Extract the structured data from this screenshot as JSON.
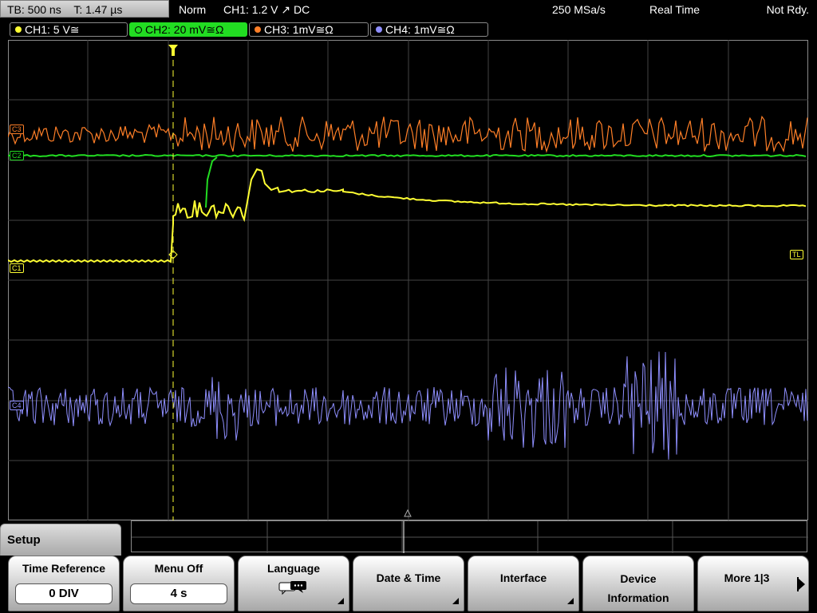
{
  "topbar": {
    "timebase": "TB: 500 ns",
    "trigger_pos": "T: 1.47 µs",
    "acq_mode": "Norm",
    "trigger": "CH1: 1.2 V ↗ DC",
    "sample_rate": "250 MSa/s",
    "mode": "Real Time",
    "status": "Not Rdy."
  },
  "channels": [
    {
      "label": "CH1: 5 V≅",
      "color": "#ffff33",
      "marker": "C1"
    },
    {
      "label": "CH2: 20 mV≅Ω",
      "color": "#22dd22",
      "marker": "C2"
    },
    {
      "label": "CH3: 1mV≅Ω",
      "color": "#ff7f27",
      "marker": "C3"
    },
    {
      "label": "CH4: 1mV≅Ω",
      "color": "#8f8fff",
      "marker": "C4"
    }
  ],
  "trigger_level_marker": "TL",
  "menu": {
    "title": "Setup",
    "softkeys": [
      {
        "label": "Time Reference",
        "value": "0 DIV"
      },
      {
        "label": "Menu Off",
        "value": "4 s"
      },
      {
        "label": "Language",
        "icon": "speech-bubble-icon"
      },
      {
        "label": "Date & Time"
      },
      {
        "label": "Interface"
      },
      {
        "label": "Device Information"
      },
      {
        "label": "More 1|3",
        "icon": "next-arrow-icon"
      }
    ]
  }
}
